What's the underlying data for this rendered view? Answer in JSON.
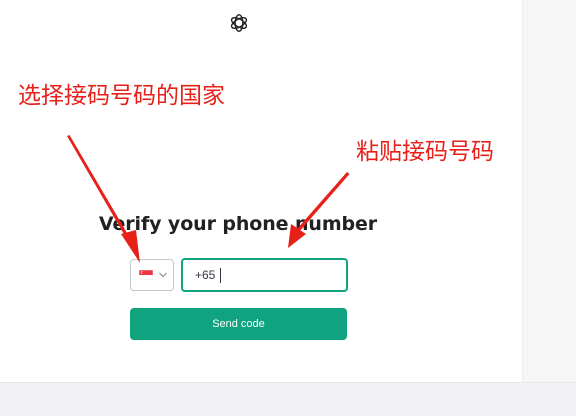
{
  "annotations": {
    "left_text": "选择接码号码的国家",
    "right_text": "粘贴接码号码",
    "color": "#e8201a"
  },
  "header": {
    "logo_icon": "openai-logo-icon"
  },
  "form": {
    "title": "Verify your phone number",
    "country": {
      "flag_icon": "singapore-flag-icon",
      "dropdown_icon": "chevron-down-icon"
    },
    "phone": {
      "dial_code": "+65",
      "value": ""
    },
    "send_label": "Send code",
    "accent_color": "#10a37f"
  }
}
